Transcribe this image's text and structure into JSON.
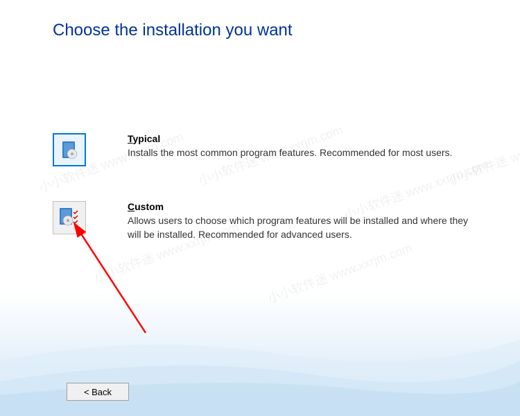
{
  "title": "Choose the installation you want",
  "options": {
    "typical": {
      "label_prefix": "T",
      "label_rest": "ypical",
      "description": "Installs the most common program features. Recommended for most users."
    },
    "custom": {
      "label_prefix": "C",
      "label_rest": "ustom",
      "description": "Allows users to choose which program features will be installed and where they will be installed. Recommended for advanced users."
    }
  },
  "buttons": {
    "back": "< Back"
  },
  "watermark": "小小软件迷 www.xxrjm.com"
}
